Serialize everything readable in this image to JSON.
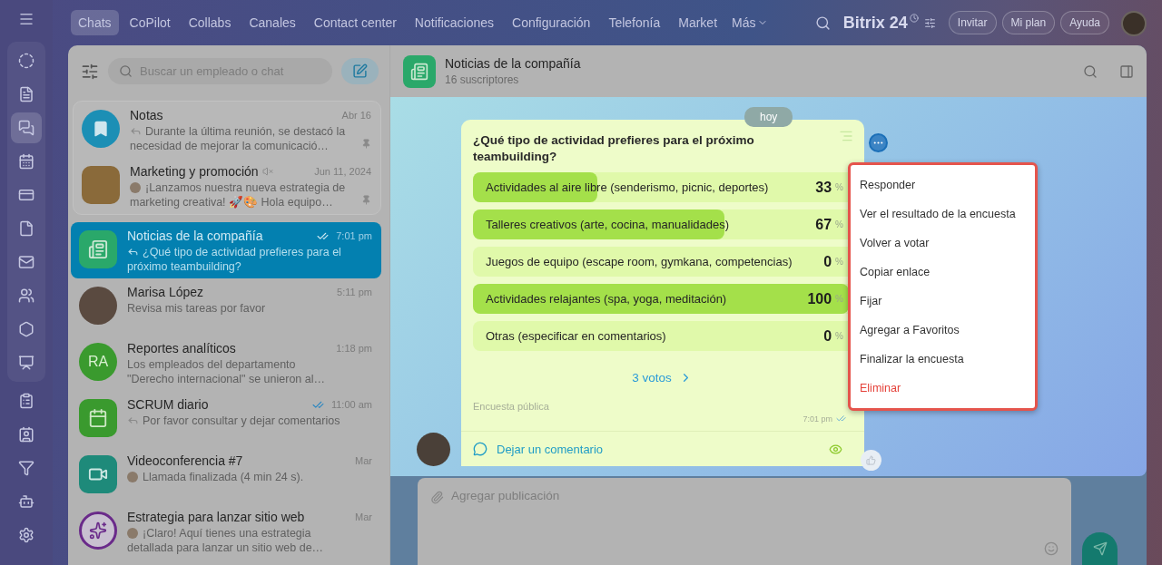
{
  "nav": {
    "tabs": [
      {
        "label": "Chats",
        "selected": true
      },
      {
        "label": "CoPilot",
        "selected": false
      },
      {
        "label": "Collabs",
        "selected": false
      },
      {
        "label": "Canales",
        "selected": false
      },
      {
        "label": "Contact center",
        "selected": false
      },
      {
        "label": "Notificaciones",
        "selected": false
      },
      {
        "label": "Configuración",
        "selected": false
      },
      {
        "label": "Telefonía",
        "selected": false
      },
      {
        "label": "Market",
        "selected": false
      }
    ],
    "more": "Más",
    "brand": "Bitrix 24",
    "buttons": [
      "Invitar",
      "Mi plan",
      "Ayuda"
    ]
  },
  "rail": {
    "group": [
      {
        "selected": false
      },
      {
        "selected": false
      },
      {
        "selected": true
      },
      {
        "selected": false
      },
      {
        "selected": false
      },
      {
        "selected": false
      },
      {
        "selected": false
      },
      {
        "selected": false
      },
      {
        "selected": false
      },
      {
        "selected": false
      }
    ],
    "items": [
      {
        "selected": false
      },
      {
        "selected": false
      },
      {
        "selected": false
      },
      {
        "selected": false
      },
      {
        "selected": false
      }
    ]
  },
  "chat_list": {
    "search": {
      "placeholder": "Buscar un empleado o chat"
    },
    "chats": [
      {
        "name": "Notas",
        "time": "Abr 16",
        "preview": "Durante la última reunión, se destacó la necesidad de mejorar la comunicació…",
        "selected": false,
        "pinned": true,
        "muted": false,
        "read": false,
        "reply": true,
        "sender_avatar": false,
        "avatar": {
          "kind": "bookmark",
          "color": "#1c8fb5"
        }
      },
      {
        "name": "Marketing y promoción",
        "time": "Jun 11, 2024",
        "preview": "¡Lanzamos nuestra nueva estrategia de marketing creativa! 🚀🎨 Hola equipo…",
        "selected": false,
        "pinned": true,
        "muted": true,
        "read": false,
        "reply": false,
        "sender_avatar": true,
        "avatar": {
          "kind": "photo",
          "color": "#8a6a3a"
        }
      },
      {
        "name": "Noticias de la compañía",
        "time": "7:01 pm",
        "preview": "¿Qué tipo de actividad prefieres para el próximo teambuilding?",
        "selected": true,
        "pinned": false,
        "muted": false,
        "read": true,
        "reply": true,
        "sender_avatar": false,
        "avatar": {
          "kind": "news",
          "color": "#2aa86a"
        }
      },
      {
        "name": "Marisa López",
        "time": "5:11 pm",
        "preview": "Revisa mis tareas por favor",
        "selected": false,
        "pinned": false,
        "muted": false,
        "read": false,
        "reply": false,
        "sender_avatar": false,
        "avatar": {
          "kind": "person",
          "color": "#5a4a40"
        }
      },
      {
        "name": "Reportes analíticos",
        "time": "1:18 pm",
        "preview": "Los empleados del departamento \"Derecho internacional\" se unieron al…",
        "selected": false,
        "pinned": false,
        "muted": false,
        "read": false,
        "reply": false,
        "sender_avatar": false,
        "avatar": {
          "kind": "initials",
          "initials": "RA",
          "color": "#3a9a2e"
        }
      },
      {
        "name": "SCRUM diario",
        "time": "11:00 am",
        "preview": "Por favor consultar y dejar comentarios",
        "selected": false,
        "pinned": false,
        "muted": false,
        "read": true,
        "reply": true,
        "sender_avatar": false,
        "avatar": {
          "kind": "calendar",
          "color": "#3a9a2e"
        }
      },
      {
        "name": "Videoconferencia #7",
        "time": "Mar",
        "preview": "Llamada finalizada (4 min 24 s).",
        "selected": false,
        "pinned": false,
        "muted": false,
        "read": false,
        "reply": false,
        "sender_avatar": true,
        "avatar": {
          "kind": "video",
          "color": "#1e8a7a"
        }
      },
      {
        "name": "Estrategia para lanzar sitio web",
        "time": "Mar",
        "preview": "¡Claro! Aquí tienes una estrategia detallada para lanzar un sitio web de…",
        "selected": false,
        "pinned": false,
        "muted": false,
        "read": false,
        "reply": false,
        "sender_avatar": true,
        "avatar": {
          "kind": "brand",
          "color": "#6a2a8a"
        }
      }
    ]
  },
  "conversation": {
    "title": "Noticias de la compañía",
    "subtitle": "16 suscriptores",
    "date": "hoy",
    "poll": {
      "question": "¿Qué tipo de actividad prefieres para el próximo teambuilding?",
      "options": [
        {
          "label": "Actividades al aire libre (senderismo, picnic, deportes)",
          "percent": "33",
          "unit": "%",
          "level": 0.33
        },
        {
          "label": "Talleres creativos (arte, cocina, manualidades)",
          "percent": "67",
          "unit": "%",
          "level": 0.67
        },
        {
          "label": "Juegos de equipo (escape room, gymkana, competencias)",
          "percent": "0",
          "unit": "%"
        },
        {
          "label": "Actividades relajantes (spa, yoga, meditación)",
          "percent": "100",
          "unit": "%",
          "level": 1
        },
        {
          "label": "Otras (especificar en comentarios)",
          "percent": "0",
          "unit": "%"
        }
      ],
      "votes": "3 votos",
      "visibility": "Encuesta pública",
      "time": "7:01 pm",
      "comment": "Dejar un comentario"
    },
    "menu": [
      {
        "label": "Responder",
        "kind": "normal"
      },
      {
        "label": "Ver el resultado de la encuesta",
        "kind": "normal"
      },
      {
        "label": "Volver a votar",
        "kind": "normal"
      },
      {
        "label": "Copiar enlace",
        "kind": "normal"
      },
      {
        "label": "Fijar",
        "kind": "normal"
      },
      {
        "label": "Agregar a Favoritos",
        "kind": "normal"
      },
      {
        "label": "Finalizar la encuesta",
        "kind": "normal"
      },
      {
        "label": "Eliminar",
        "kind": "danger"
      }
    ],
    "composer": {
      "placeholder": "Agregar publicación"
    }
  }
}
